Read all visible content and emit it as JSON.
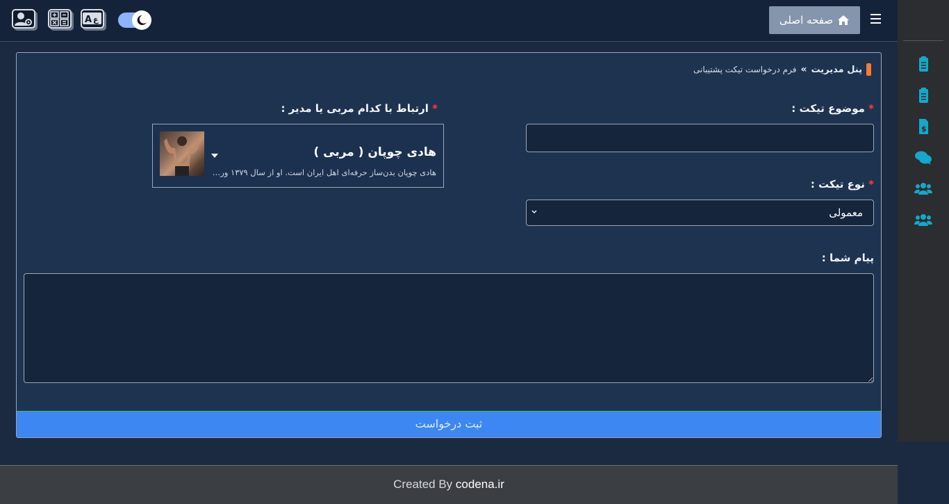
{
  "header": {
    "home_label": "صفحه اصلی",
    "icons": [
      "user-settings-icon",
      "calculator-icon",
      "translate-icon",
      "dark-mode-toggle",
      "menu-icon"
    ]
  },
  "sidebar": {
    "items": [
      {
        "icon": "clipboard-list-icon"
      },
      {
        "icon": "clipboard-check-icon"
      },
      {
        "icon": "invoice-dollar-icon"
      },
      {
        "icon": "comments-icon"
      },
      {
        "icon": "users-icon"
      },
      {
        "icon": "users-icon"
      }
    ],
    "icon_color": "#14a8c9"
  },
  "breadcrumb": {
    "root": "پنل مدیریت",
    "separator": "»",
    "current": "فرم درخواست تیکت پشتیبانی"
  },
  "form": {
    "subject_label": "موضوع تیکت :",
    "subject_value": "",
    "type_label": "نوع تیکت :",
    "type_value": "معمولی",
    "coach_label": "ارتباط با کدام مربی یا مدیر :",
    "coach_name": "هادی چوپان ( مربی )",
    "coach_desc": "هادی چوپان بدن‌ساز حرفه‌ای اهل ایران است. او از سال ۱۳۷۹ ورز...",
    "message_label": "پیام شما :",
    "message_value": "",
    "required_mark": "*",
    "submit_label": "ثبت درخواست"
  },
  "footer": {
    "prefix": "Created By",
    "brand": "codena.ir"
  },
  "colors": {
    "accent": "#3d87f2",
    "required": "#ff3b3b",
    "breadcrumb_marker": "#ff7a2a",
    "background": "#1b2a40"
  }
}
